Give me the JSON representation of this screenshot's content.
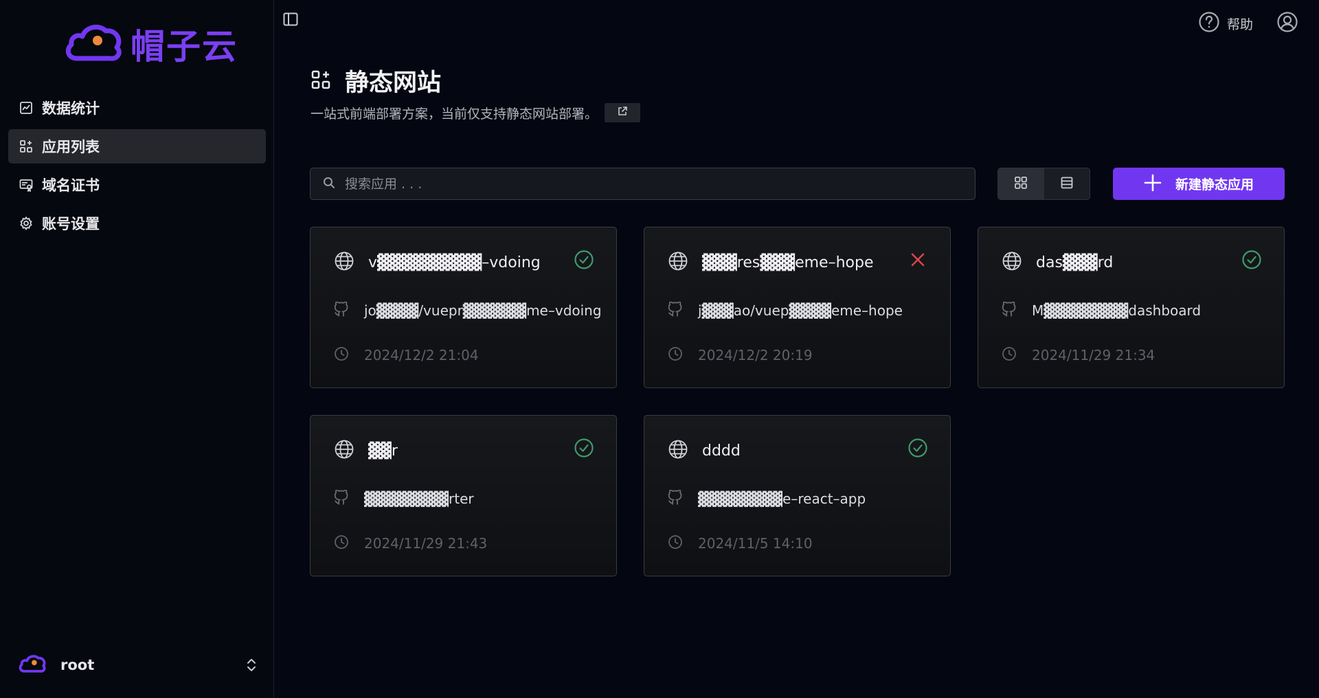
{
  "brand": {
    "name": "帽子云",
    "accent": "#7137f0"
  },
  "sidebar": {
    "items": [
      {
        "label": "数据统计",
        "icon": "chart-icon",
        "active": false
      },
      {
        "label": "应用列表",
        "icon": "apps-icon",
        "active": true
      },
      {
        "label": "域名证书",
        "icon": "certificate-icon",
        "active": false
      },
      {
        "label": "账号设置",
        "icon": "gear-icon",
        "active": false
      }
    ],
    "user": {
      "name": "root"
    }
  },
  "header": {
    "help_label": "帮助"
  },
  "page": {
    "title": "静态网站",
    "subtitle": "一站式前端部署方案，当前仅支持静态网站部署。"
  },
  "search": {
    "placeholder": "搜索应用 . . ."
  },
  "toolbar": {
    "new_label": "新建静态应用",
    "view_mode": "grid"
  },
  "cards": [
    {
      "name": "v▓▓▓▓▓▓▓▓▓–vdoing",
      "repo": "jo▓▓▓▓/vuepr▓▓▓▓▓▓me–vdoing",
      "time": "2024/12/2 21:04",
      "status": "success"
    },
    {
      "name": "▓▓▓res▓▓▓eme–hope",
      "repo": "j▓▓▓ao/vuep▓▓▓▓eme–hope",
      "time": "2024/12/2 20:19",
      "status": "failed"
    },
    {
      "name": "das▓▓▓rd",
      "repo": "M▓▓▓▓▓▓▓▓dashboard",
      "time": "2024/11/29 21:34",
      "status": "success"
    },
    {
      "name": "▓▓r",
      "repo": "▓▓▓▓▓▓▓▓rter",
      "time": "2024/11/29 21:43",
      "status": "success"
    },
    {
      "name": "dddd",
      "repo": "▓▓▓▓▓▓▓▓e–react–app",
      "time": "2024/11/5 14:10",
      "status": "success"
    }
  ],
  "colors": {
    "success": "#3f9a6a",
    "failed": "#e0464b"
  }
}
